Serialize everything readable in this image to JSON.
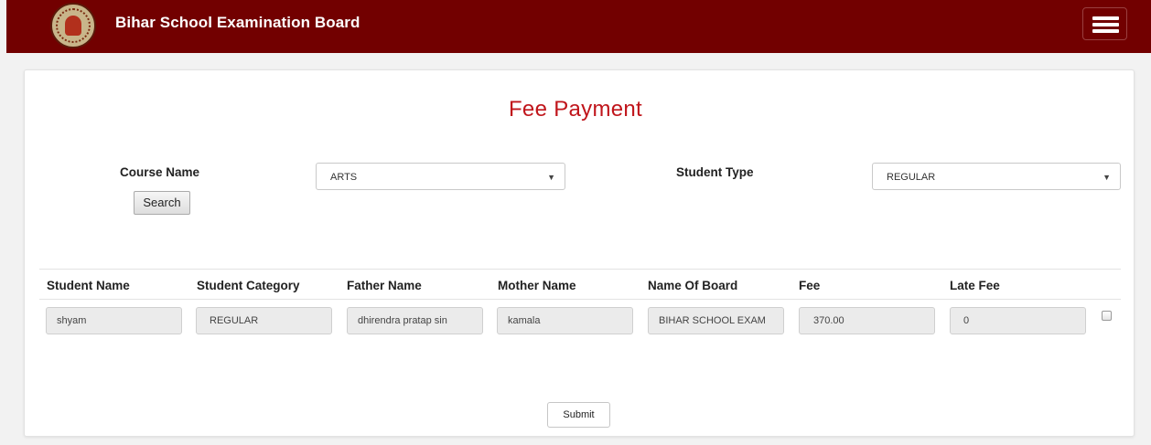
{
  "header": {
    "brand": "Bihar School Examination Board",
    "logo_icon": "bseb-emblem-icon",
    "menu_icon": "hamburger-menu-icon"
  },
  "page_title": "Fee Payment",
  "filters": {
    "course_name_label": "Course Name",
    "course_name_value": "ARTS",
    "student_type_label": "Student Type",
    "student_type_value": "REGULAR",
    "search_label": "Search"
  },
  "table": {
    "headers": [
      "Student Name",
      "Student Category",
      "Father Name",
      "Mother Name",
      "Name Of Board",
      "Fee",
      "Late Fee"
    ],
    "rows": [
      {
        "student_name": "shyam",
        "student_category": "REGULAR",
        "father_name": "dhirendra pratap sin",
        "mother_name": "kamala",
        "name_of_board": "BIHAR SCHOOL EXAM",
        "fee": "370.00",
        "late_fee": "0",
        "selected": false
      }
    ]
  },
  "submit_label": "Submit",
  "colors": {
    "header_bg": "#720000",
    "title": "#c0151b",
    "page_bg": "#f2f2f2"
  }
}
